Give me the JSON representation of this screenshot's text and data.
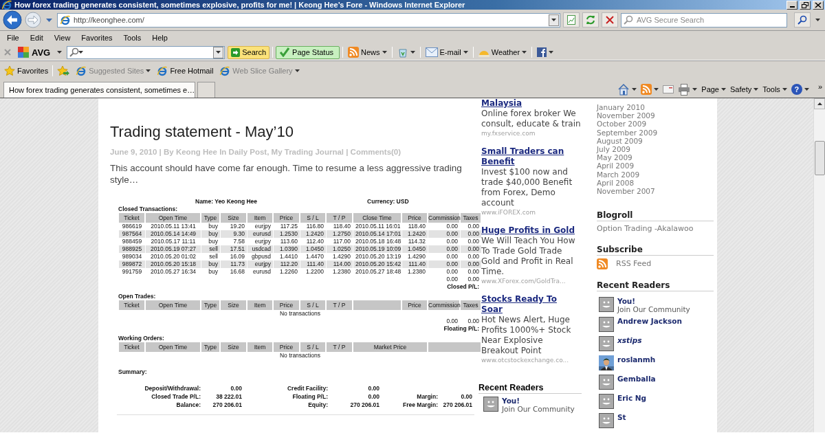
{
  "window": {
    "title": "How forex trading generates consistent, sometimes explosive, profits for me! | Keong Hee’s Fore - Windows Internet Explorer"
  },
  "address_bar": {
    "url": "http://keonghee.com/"
  },
  "search": {
    "placeholder": "AVG Secure Search"
  },
  "menu": [
    "File",
    "Edit",
    "View",
    "Favorites",
    "Tools",
    "Help"
  ],
  "avg_toolbar": {
    "logo": "AVG",
    "buttons": [
      {
        "kind": "search",
        "label": "Search"
      },
      {
        "kind": "status",
        "label": "Page Status"
      },
      {
        "kind": "news",
        "label": "News"
      },
      {
        "kind": "bin"
      },
      {
        "kind": "mail",
        "label": "E-mail"
      },
      {
        "kind": "weather",
        "label": "Weather"
      },
      {
        "kind": "social"
      }
    ]
  },
  "favorites_bar": {
    "label": "Favorites",
    "links": [
      {
        "label": "Suggested Sites",
        "disabled": true,
        "menu": true
      },
      {
        "label": "Free Hotmail",
        "disabled": false,
        "menu": false
      },
      {
        "label": "Web Slice Gallery",
        "disabled": true,
        "menu": true
      }
    ]
  },
  "tabs": [
    {
      "label": "How forex trading generates consistent, sometimes e…",
      "selected": true
    }
  ],
  "command_bar": {
    "items": [
      {
        "kind": "home"
      },
      {
        "kind": "feeds"
      },
      {
        "kind": "read-mail"
      },
      {
        "kind": "print"
      },
      {
        "kind": "menu",
        "label": "Page"
      },
      {
        "kind": "menu",
        "label": "Safety"
      },
      {
        "kind": "menu",
        "label": "Tools"
      },
      {
        "kind": "help",
        "label": "?"
      }
    ],
    "more": "»"
  },
  "post": {
    "title": "Trading statement - May’10",
    "meta": "June 9, 2010 | By Keong Hee In Daily Post, My Trading Journal | Comments(0)",
    "excerpt": "This account should have come far enough. Time to resume a less aggressive trading style…"
  },
  "statement": {
    "name": "Name: Yeo Keong Hee",
    "currency": "Currency: USD",
    "closed": {
      "heading": "Closed Transactions:",
      "columns": [
        "Ticket",
        "Open Time",
        "Type",
        "Size",
        "Item",
        "Price",
        "S / L",
        "T / P",
        "Close Time",
        "Price",
        "Commission",
        "Taxes"
      ],
      "rows": [
        [
          "986619",
          "2010.05.11 13:41",
          "buy",
          "19.20",
          "eurjpy",
          "117.25",
          "116.80",
          "118.40",
          "2010.05.11 16:01",
          "118.40",
          "0.00",
          "0.00"
        ],
        [
          "987564",
          "2010.05.14 14:49",
          "buy",
          "9.30",
          "eurusd",
          "1.2530",
          "1.2420",
          "1.2750",
          "2010.05.14 17:01",
          "1.2420",
          "0.00",
          "0.00"
        ],
        [
          "988459",
          "2010.05.17 11:11",
          "buy",
          "7.58",
          "eurjpy",
          "113.60",
          "112.40",
          "117.00",
          "2010.05.18 16:48",
          "114.32",
          "0.00",
          "0.00"
        ],
        [
          "988925",
          "2010.05.19 07:27",
          "sell",
          "17.51",
          "usdcad",
          "1.0390",
          "1.0450",
          "1.0250",
          "2010.05.19 10:09",
          "1.0450",
          "0.00",
          "0.00"
        ],
        [
          "989034",
          "2010.05.20 01:02",
          "sell",
          "16.09",
          "gbpusd",
          "1.4410",
          "1.4470",
          "1.4290",
          "2010.05.20 13:19",
          "1.4290",
          "0.00",
          "0.00"
        ],
        [
          "989872",
          "2010.05.20 15:18",
          "buy",
          "11.73",
          "eurjpy",
          "112.20",
          "111.40",
          "114.00",
          "2010.05.20 15:42",
          "111.40",
          "0.00",
          "0.00"
        ],
        [
          "991759",
          "2010.05.27 16:34",
          "buy",
          "16.68",
          "eurusd",
          "1.2260",
          "1.2200",
          "1.2380",
          "2010.05.27 18:48",
          "1.2380",
          "0.00",
          "0.00"
        ]
      ],
      "totals": [
        "0.00",
        "0.00"
      ],
      "total_label": "Closed P/L:"
    },
    "open": {
      "heading": "Open Trades:",
      "columns": [
        "Ticket",
        "Open Time",
        "Type",
        "Size",
        "Item",
        "Price",
        "S / L",
        "T / P",
        null,
        "Price",
        "Commission",
        "Taxes"
      ],
      "empty": "No transactions",
      "totals": [
        "0.00",
        "0.00"
      ],
      "total_label": "Floating P/L:"
    },
    "working": {
      "heading": "Working Orders:",
      "columns": [
        "Ticket",
        "Open Time",
        "Type",
        "Size",
        "Item",
        "Price",
        "S / L",
        "T / P",
        "Market Price",
        null
      ],
      "empty": "No transactions"
    },
    "summary": {
      "heading": "Summary:",
      "rows": [
        [
          "Deposit/Withdrawal:",
          "0.00",
          "Credit Facility:",
          "0.00"
        ],
        [
          "Closed Trade P/L:",
          "38 222.01",
          "Floating P/L:",
          "0.00",
          "Margin:",
          "0.00"
        ],
        [
          "Balance:",
          "270 206.01",
          "Equity:",
          "270 206.01",
          "Free Margin:",
          "270 206.01"
        ]
      ]
    }
  },
  "ads": [
    {
      "title": "Malaysia",
      "text": "Online forex broker We consult, educate & train",
      "url": "my.fxservice.com"
    },
    {
      "title": "Small Traders can Benefit",
      "text": "Invest $100 now and trade $40,000 Benefit from Forex, Demo account",
      "url": "www.iFOREX.com"
    },
    {
      "title": "Huge Profits in Gold",
      "text": "We Will Teach You How To Trade Gold Trade Gold and Profit in Real Time.",
      "url": "www.XForex.com/GoldTra..."
    },
    {
      "title": "Stocks Ready To Soar",
      "text": "Hot News Alert, Huge Profits 1000%+ Stock Near Explosive Breakout Point",
      "url": "www.otcstockexchange.co..."
    }
  ],
  "ad_column_readers": {
    "heading": "Recent Readers",
    "readers": [
      {
        "name": "You!",
        "note": "Join Our Community",
        "photo": false,
        "italic": false
      }
    ]
  },
  "archives": [
    "January 2010",
    "November 2009",
    "October 2009",
    "September 2009",
    "August 2009",
    "July 2009",
    "May 2009",
    "April 2009",
    "March 2009",
    "April 2008",
    "November 2007"
  ],
  "blogroll": {
    "heading": "Blogroll",
    "links": [
      "Option Trading -Akalawoo"
    ]
  },
  "subscribe": {
    "heading": "Subscribe",
    "links": [
      "RSS Feed"
    ]
  },
  "recent_readers": {
    "heading": "Recent Readers",
    "readers": [
      {
        "name": "You!",
        "note": "Join Our Community",
        "photo": false,
        "italic": false
      },
      {
        "name": "Andrew Jackson",
        "photo": false,
        "italic": false
      },
      {
        "name": "xstips",
        "photo": false,
        "italic": true
      },
      {
        "name": "roslanmh",
        "photo": true,
        "italic": false
      },
      {
        "name": "Gemballa",
        "photo": false,
        "italic": false
      },
      {
        "name": "Eric Ng",
        "photo": false,
        "italic": false
      },
      {
        "name": "St",
        "photo": false,
        "italic": false
      }
    ]
  }
}
